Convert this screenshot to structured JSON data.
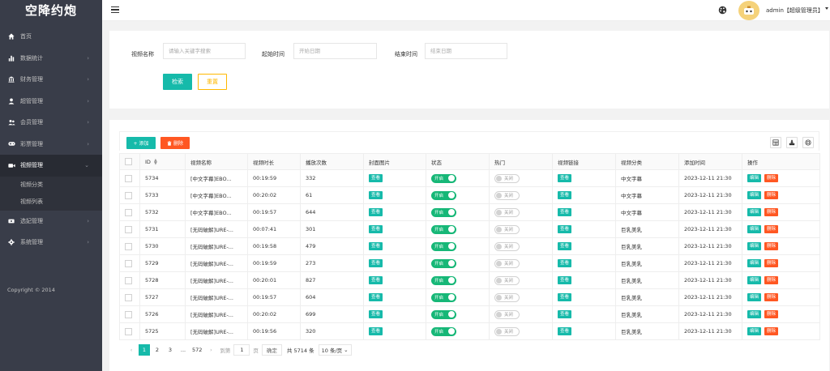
{
  "sidebar": {
    "logo": "空降约炮",
    "items": [
      {
        "label": "首页",
        "icon": "home-icon",
        "arrow": false
      },
      {
        "label": "数据统计",
        "icon": "bar-chart-icon",
        "arrow": true
      },
      {
        "label": "财务管理",
        "icon": "bank-icon",
        "arrow": true
      },
      {
        "label": "超管管理",
        "icon": "user-icon",
        "arrow": true
      },
      {
        "label": "会员管理",
        "icon": "users-icon",
        "arrow": true
      },
      {
        "label": "彩票管理",
        "icon": "gamepad-icon",
        "arrow": true
      },
      {
        "label": "视频管理",
        "icon": "video-icon",
        "arrow": true,
        "expanded": true
      },
      {
        "label": "选妃管理",
        "icon": "ticket-icon",
        "arrow": true
      },
      {
        "label": "系统管理",
        "icon": "gear-icon",
        "arrow": true
      }
    ],
    "submenu": [
      "视频分类",
      "视频列表"
    ],
    "copyright": "Copyright © 2014"
  },
  "header": {
    "user": "admin【超级管理员】"
  },
  "search": {
    "name_label": "视频名称",
    "name_placeholder": "请输入关键字搜索",
    "start_label": "起始时间",
    "start_placeholder": "开始日期",
    "end_label": "结束时间",
    "end_placeholder": "结束日期",
    "search_btn": "检索",
    "reset_btn": "重置"
  },
  "toolbar": {
    "add_label": "+ 添加",
    "delete_label": "删除"
  },
  "table": {
    "columns": [
      "ID",
      "视频名称",
      "视频时长",
      "播放次数",
      "封面图片",
      "状态",
      "热门",
      "视频链接",
      "视频分类",
      "添加时间",
      "操作"
    ],
    "view_label": "查看",
    "on_label": "开启",
    "off_label": "关闭",
    "edit_label": "编辑",
    "del_label": "删除",
    "rows": [
      {
        "id": "5734",
        "name": "[中文字幕]EBO...",
        "duration": "00:19:59",
        "plays": "332",
        "category": "中文字幕",
        "added": "2023-12-11 21:30"
      },
      {
        "id": "5733",
        "name": "[中文字幕]EBO...",
        "duration": "00:20:02",
        "plays": "61",
        "category": "中文字幕",
        "added": "2023-12-11 21:30"
      },
      {
        "id": "5732",
        "name": "[中文字幕]EBO...",
        "duration": "00:19:57",
        "plays": "644",
        "category": "中文字幕",
        "added": "2023-12-11 21:30"
      },
      {
        "id": "5731",
        "name": "[无码破解]URE-...",
        "duration": "00:07:41",
        "plays": "301",
        "category": "巨乳美乳",
        "added": "2023-12-11 21:30"
      },
      {
        "id": "5730",
        "name": "[无码破解]URE-...",
        "duration": "00:19:58",
        "plays": "479",
        "category": "巨乳美乳",
        "added": "2023-12-11 21:30"
      },
      {
        "id": "5729",
        "name": "[无码破解]URE-...",
        "duration": "00:19:59",
        "plays": "273",
        "category": "巨乳美乳",
        "added": "2023-12-11 21:30"
      },
      {
        "id": "5728",
        "name": "[无码破解]URE-...",
        "duration": "00:20:01",
        "plays": "827",
        "category": "巨乳美乳",
        "added": "2023-12-11 21:30"
      },
      {
        "id": "5727",
        "name": "[无码破解]URE-...",
        "duration": "00:19:57",
        "plays": "604",
        "category": "巨乳美乳",
        "added": "2023-12-11 21:30"
      },
      {
        "id": "5726",
        "name": "[无码破解]URE-...",
        "duration": "00:20:02",
        "plays": "699",
        "category": "巨乳美乳",
        "added": "2023-12-11 21:30"
      },
      {
        "id": "5725",
        "name": "[无码破解]URE-...",
        "duration": "00:19:56",
        "plays": "320",
        "category": "巨乳美乳",
        "added": "2023-12-11 21:30"
      }
    ]
  },
  "pager": {
    "pages": [
      "1",
      "2",
      "3",
      "...",
      "572"
    ],
    "goto_label": "到第",
    "goto_value": "1",
    "page_unit": "页",
    "confirm": "确定",
    "total": "共 5714 条",
    "page_size": "10 条/页"
  },
  "colors": {
    "sidebar_bg": "#393d49",
    "primary": "#16baaa",
    "danger": "#ff5722",
    "warning": "#ffb800",
    "switch_on": "#16b777"
  }
}
